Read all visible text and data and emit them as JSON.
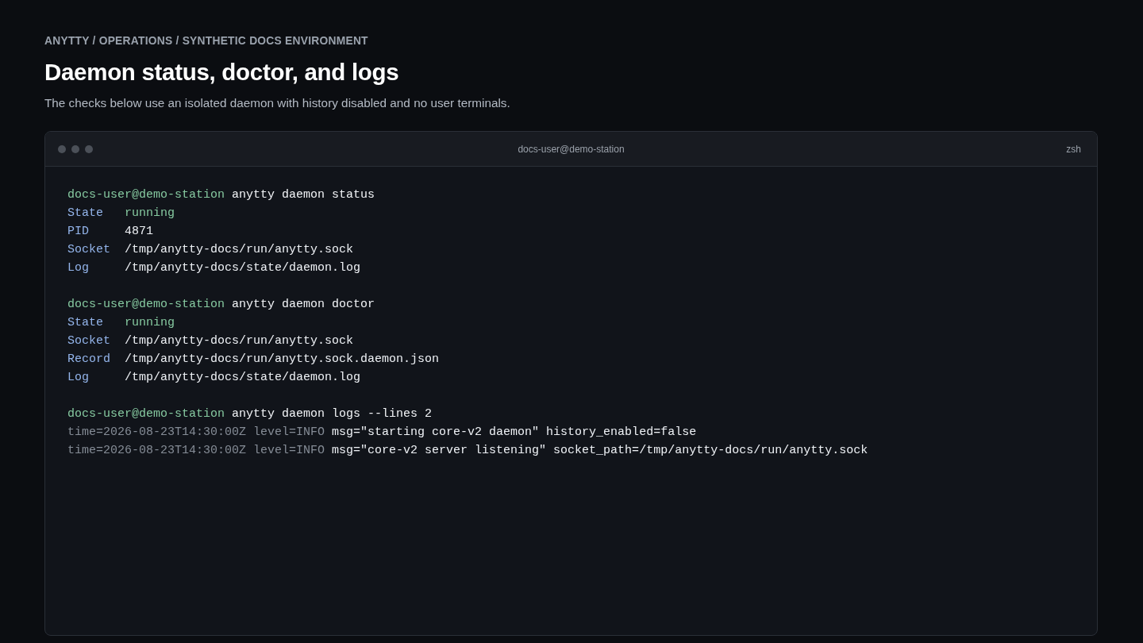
{
  "breadcrumb": "ANYTTY / OPERATIONS / SYNTHETIC DOCS ENVIRONMENT",
  "title": "Daemon status, doctor, and logs",
  "description": "The checks below use an isolated daemon with history disabled and no user terminals.",
  "terminal": {
    "title": "docs-user@demo-station",
    "shell": "zsh",
    "sessions": [
      {
        "prompt": "docs-user@demo-station",
        "command": "anytty daemon status",
        "output": [
          {
            "kind": "status",
            "label": "State",
            "value": "running"
          },
          {
            "kind": "field",
            "label": "PID",
            "value": "4871"
          },
          {
            "kind": "field",
            "label": "Socket",
            "value": "/tmp/anytty-docs/run/anytty.sock"
          },
          {
            "kind": "field",
            "label": "Log",
            "value": "/tmp/anytty-docs/state/daemon.log"
          }
        ]
      },
      {
        "prompt": "docs-user@demo-station",
        "command": "anytty daemon doctor",
        "output": [
          {
            "kind": "status",
            "label": "State",
            "value": "running"
          },
          {
            "kind": "field",
            "label": "Socket",
            "value": "/tmp/anytty-docs/run/anytty.sock"
          },
          {
            "kind": "field",
            "label": "Record",
            "value": "/tmp/anytty-docs/run/anytty.sock.daemon.json"
          },
          {
            "kind": "field",
            "label": "Log",
            "value": "/tmp/anytty-docs/state/daemon.log"
          }
        ]
      },
      {
        "prompt": "docs-user@demo-station",
        "command": "anytty daemon logs --lines 2",
        "output": [
          {
            "kind": "log",
            "time": "time=2026-08-23T14:30:00Z",
            "level": "level=INFO",
            "message": "msg=\"starting core-v2 daemon\" history_enabled=false"
          },
          {
            "kind": "log",
            "time": "time=2026-08-23T14:30:00Z",
            "level": "level=INFO",
            "message": "msg=\"core-v2 server listening\" socket_path=/tmp/anytty-docs/run/anytty.sock"
          }
        ]
      }
    ]
  }
}
